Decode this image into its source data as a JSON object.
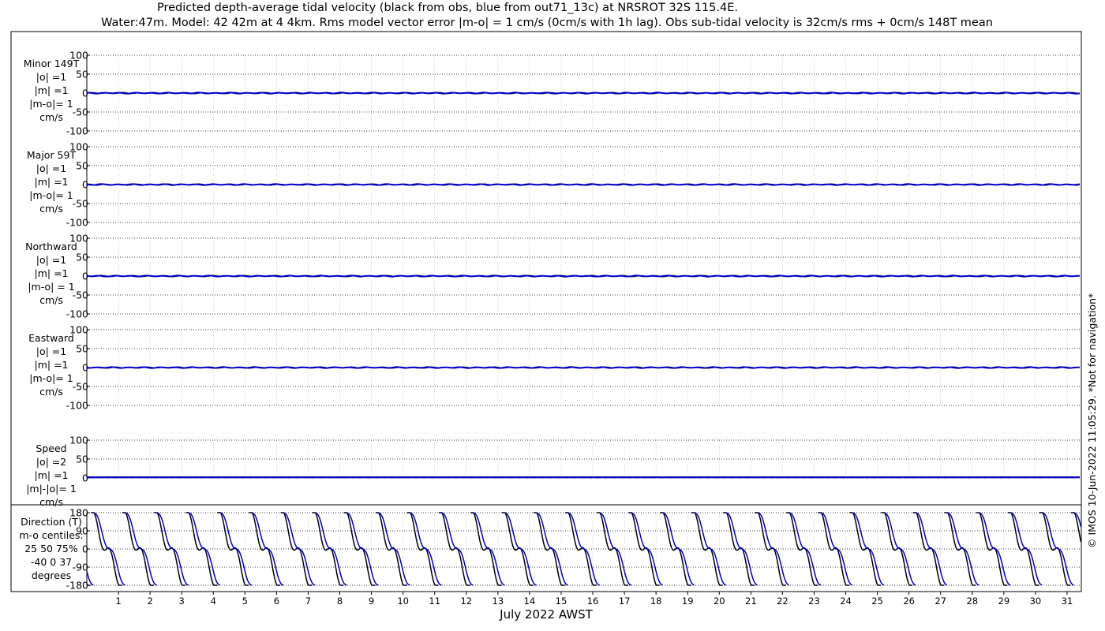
{
  "title_line1": "Predicted depth-average tidal velocity (black from obs, blue from out71_13c) at NRSROT 32S 115.4E.",
  "title_line2": "Water:47m. Model: 42 42m at 4 4km. Rms model vector error |m-o| = 1 cm/s (0cm/s with 1h lag). Obs sub-tidal velocity is 32cm/s rms + 0cm/s 148T mean",
  "copyright": "© IMOS 10-Jun-2022 11:05:29. *Not for navigation*",
  "colors": {
    "obs": "#000000",
    "model": "#0000cc"
  },
  "chart_data": {
    "type": "line",
    "xlabel": "July 2022 AWST",
    "x_ticks": [
      1,
      2,
      3,
      4,
      5,
      6,
      7,
      8,
      9,
      10,
      11,
      12,
      13,
      14,
      15,
      16,
      17,
      18,
      19,
      20,
      21,
      22,
      23,
      24,
      25,
      26,
      27,
      28,
      29,
      30,
      31
    ],
    "x_range": [
      0,
      31.45
    ],
    "grid": true,
    "panels": [
      {
        "name": "minor",
        "labels": [
          "Minor 149T",
          "|o| =1",
          "|m| =1",
          "|m-o|= 1",
          "cm/s"
        ],
        "ylim": [
          -100,
          100
        ],
        "yticks": [
          100,
          50,
          0,
          -50,
          -100
        ],
        "ytick_labels": [
          "100",
          "50",
          "0",
          "-50",
          "-100"
        ],
        "series": [
          {
            "color": "obs",
            "amplitude": 1
          },
          {
            "color": "model",
            "amplitude": 1
          }
        ]
      },
      {
        "name": "major",
        "labels": [
          "Major 59T",
          "|o| =1",
          "|m| =1",
          "|m-o|= 1",
          "cm/s"
        ],
        "ylim": [
          -100,
          100
        ],
        "yticks": [
          100,
          50,
          0,
          -50,
          -100
        ],
        "ytick_labels": [
          "100",
          "50",
          "0",
          "-50",
          "-100"
        ],
        "series": [
          {
            "color": "obs",
            "amplitude": 1
          },
          {
            "color": "model",
            "amplitude": 1
          }
        ]
      },
      {
        "name": "northward",
        "labels": [
          "Northward",
          "|o| =1",
          "|m| =1",
          "|m-o| = 1",
          "cm/s"
        ],
        "ylim": [
          -100,
          100
        ],
        "yticks": [
          100,
          50,
          0,
          -50,
          -100
        ],
        "ytick_labels": [
          "100",
          "50",
          "0",
          "-50",
          "-100"
        ],
        "series": [
          {
            "color": "obs",
            "amplitude": 1
          },
          {
            "color": "model",
            "amplitude": 1
          }
        ]
      },
      {
        "name": "eastward",
        "labels": [
          "Eastward",
          "|o| =1",
          "|m| =1",
          "|m-o|= 1",
          "cm/s"
        ],
        "ylim": [
          -100,
          100
        ],
        "yticks": [
          100,
          50,
          0,
          -50,
          -100
        ],
        "ytick_labels": [
          "100",
          "50",
          "0",
          "-50",
          "-100"
        ],
        "series": [
          {
            "color": "obs",
            "amplitude": 1
          },
          {
            "color": "model",
            "amplitude": 1
          }
        ]
      },
      {
        "name": "speed",
        "labels": [
          "Speed",
          "|o| =2",
          "|m| =1",
          "|m|-|o|= 1",
          "cm/s"
        ],
        "ylim": [
          0,
          100
        ],
        "yticks": [
          100,
          50,
          0
        ],
        "ytick_labels": [
          "100",
          "50",
          "0"
        ],
        "series": [
          {
            "color": "obs",
            "mean": 2
          },
          {
            "color": "model",
            "mean": 1
          }
        ]
      }
    ],
    "direction_panel": {
      "labels": [
        "Direction (T)",
        "m-o centiles:",
        "25  50  75%",
        "-40   0  37",
        "degrees"
      ],
      "ylim": [
        -180,
        180
      ],
      "yticks": [
        180,
        90,
        0,
        -90,
        -180
      ],
      "ytick_labels": [
        "180",
        "90",
        "0",
        "-90",
        "-180"
      ],
      "tidal_period_days": 1.0,
      "obs_phase_days": 0.12,
      "model_phase_days": 0.22
    }
  }
}
